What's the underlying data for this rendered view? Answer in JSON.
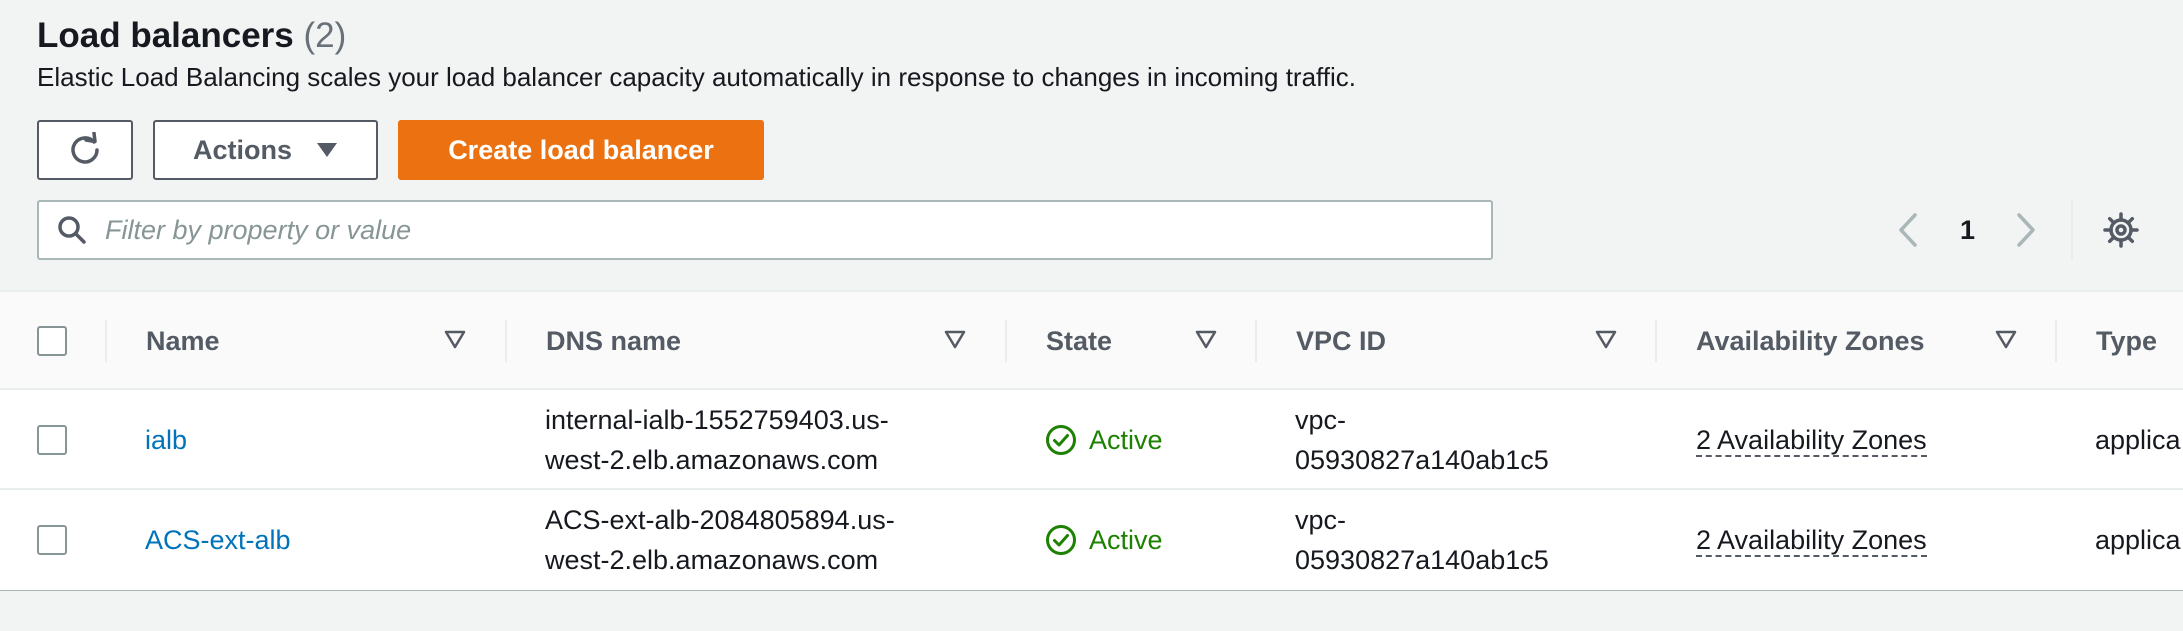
{
  "header": {
    "title": "Load balancers",
    "count": "(2)",
    "description": "Elastic Load Balancing scales your load balancer capacity automatically in response to changes in incoming traffic."
  },
  "toolbar": {
    "refresh_icon": "refresh-icon",
    "actions_label": "Actions",
    "create_label": "Create load balancer"
  },
  "filter": {
    "placeholder": "Filter by property or value",
    "value": ""
  },
  "pagination": {
    "current_page": "1"
  },
  "colors": {
    "primary": "#ec7211",
    "link": "#0073bb",
    "success": "#1d8102"
  },
  "table": {
    "columns": [
      "Name",
      "DNS name",
      "State",
      "VPC ID",
      "Availability Zones",
      "Type"
    ],
    "rows": [
      {
        "name": "ialb",
        "dns_line1": "internal-ialb-1552759403.us-",
        "dns_line2": "west-2.elb.amazonaws.com",
        "state": "Active",
        "vpc_line1": "vpc-",
        "vpc_line2": "05930827a140ab1c5",
        "az": "2 Availability Zones",
        "type": "applica"
      },
      {
        "name": "ACS-ext-alb",
        "dns_line1": "ACS-ext-alb-2084805894.us-",
        "dns_line2": "west-2.elb.amazonaws.com",
        "state": "Active",
        "vpc_line1": "vpc-",
        "vpc_line2": "05930827a140ab1c5",
        "az": "2 Availability Zones",
        "type": "applica"
      }
    ]
  }
}
